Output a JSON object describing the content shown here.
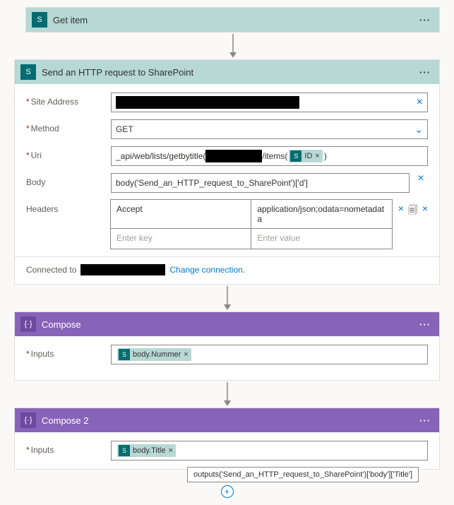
{
  "actions": {
    "get_item": {
      "title": "Get item"
    },
    "http": {
      "title": "Send an HTTP request to SharePoint",
      "labels": {
        "site": "Site Address",
        "method": "Method",
        "uri": "Uri",
        "body": "Body",
        "headers": "Headers"
      },
      "values": {
        "method": "GET",
        "uri_prefix": "_api/web/lists/getbytitle(",
        "uri_mid": "/items(",
        "uri_token": "ID",
        "uri_suffix": ")",
        "body": "body('Send_an_HTTP_request_to_SharePoint')['d']",
        "header_key": "Accept",
        "header_val": "application/json;odata=nometadata",
        "header_key_ph": "Enter key",
        "header_val_ph": "Enter value"
      },
      "connection": {
        "label": "Connected to",
        "change": "Change connection."
      }
    },
    "compose1": {
      "title": "Compose",
      "label": "Inputs",
      "token": "body.Nummer"
    },
    "compose2": {
      "title": "Compose 2",
      "label": "Inputs",
      "token": "body.Title"
    }
  },
  "tooltip": "outputs('Send_an_HTTP_request_to_SharePoint')['body']['Title']"
}
